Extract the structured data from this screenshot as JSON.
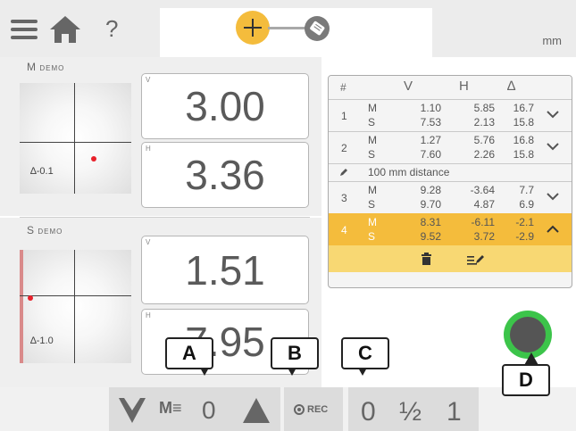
{
  "header": {
    "unit": "mm",
    "help_label": "?"
  },
  "m_panel": {
    "label": "M",
    "sublabel": "DEMO",
    "angle": "∆-0.1",
    "v_tag": "V",
    "v_value": "3.00",
    "h_tag": "H",
    "h_value": "3.36"
  },
  "s_panel": {
    "label": "S",
    "sublabel": "DEMO",
    "angle": "∆-1.0",
    "v_tag": "V",
    "v_value": "1.51",
    "h_tag": "H",
    "h_value": "7.95"
  },
  "table": {
    "headers": [
      "#",
      "V",
      "H",
      "∆"
    ],
    "rows": [
      {
        "n": "1",
        "m": [
          "M",
          "1.10",
          "5.85",
          "16.7"
        ],
        "s": [
          "S",
          "7.53",
          "2.13",
          "15.8"
        ]
      },
      {
        "n": "2",
        "m": [
          "M",
          "1.27",
          "5.76",
          "16.8"
        ],
        "s": [
          "S",
          "7.60",
          "2.26",
          "15.8"
        ]
      },
      {
        "n": "3",
        "m": [
          "M",
          "9.28",
          "-3.64",
          "7.7"
        ],
        "s": [
          "S",
          "9.70",
          "4.87",
          "6.9"
        ]
      },
      {
        "n": "4",
        "m": [
          "M",
          "8.31",
          "-6.11",
          "-2.1"
        ],
        "s": [
          "S",
          "9.52",
          "3.72",
          "-2.9"
        ]
      }
    ],
    "note": "100 mm distance"
  },
  "bottom": {
    "filter_value": "0",
    "rec_label": "REC",
    "res_options": [
      "0",
      "½",
      "1"
    ]
  },
  "callouts": {
    "a": "A",
    "b": "B",
    "c": "C",
    "d": "D"
  },
  "colors": {
    "accent": "#f4bc3c",
    "green": "#3cc44a",
    "red": "#e8202a"
  }
}
